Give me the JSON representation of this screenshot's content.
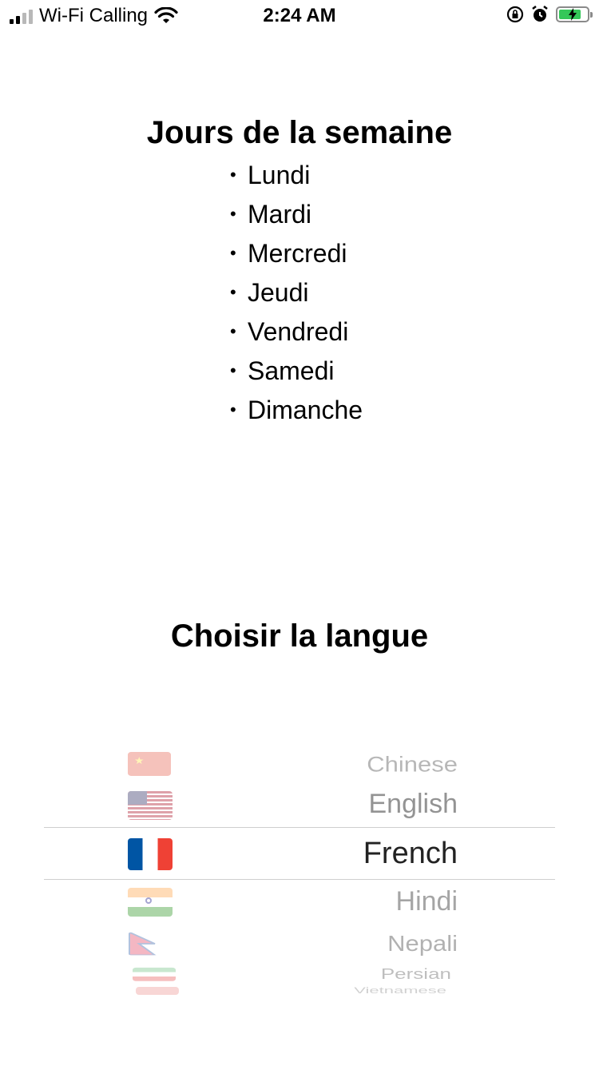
{
  "status_bar": {
    "carrier": "Wi-Fi Calling",
    "time": "2:24 AM",
    "icons": {
      "signal": "signal-bars-icon",
      "wifi": "wifi-icon",
      "orientation_lock": "orientation-lock-icon",
      "alarm": "alarm-icon",
      "battery": "battery-charging-icon"
    },
    "battery_level": 0.8,
    "battery_color": "#34c759"
  },
  "days": {
    "title": "Jours de la semaine",
    "items": [
      "Lundi",
      "Mardi",
      "Mercredi",
      "Jeudi",
      "Vendredi",
      "Samedi",
      "Dimanche"
    ]
  },
  "language": {
    "title": "Choisir la langue",
    "selected": "French",
    "options": [
      {
        "label": "Chinese",
        "flag": "china-flag-icon"
      },
      {
        "label": "English",
        "flag": "usa-flag-icon"
      },
      {
        "label": "French",
        "flag": "france-flag-icon"
      },
      {
        "label": "Hindi",
        "flag": "india-flag-icon"
      },
      {
        "label": "Nepali",
        "flag": "nepal-flag-icon"
      },
      {
        "label": "Persian",
        "flag": "iran-flag-icon"
      },
      {
        "label": "Vietnamese",
        "flag": "vietnam-flag-icon"
      }
    ]
  }
}
